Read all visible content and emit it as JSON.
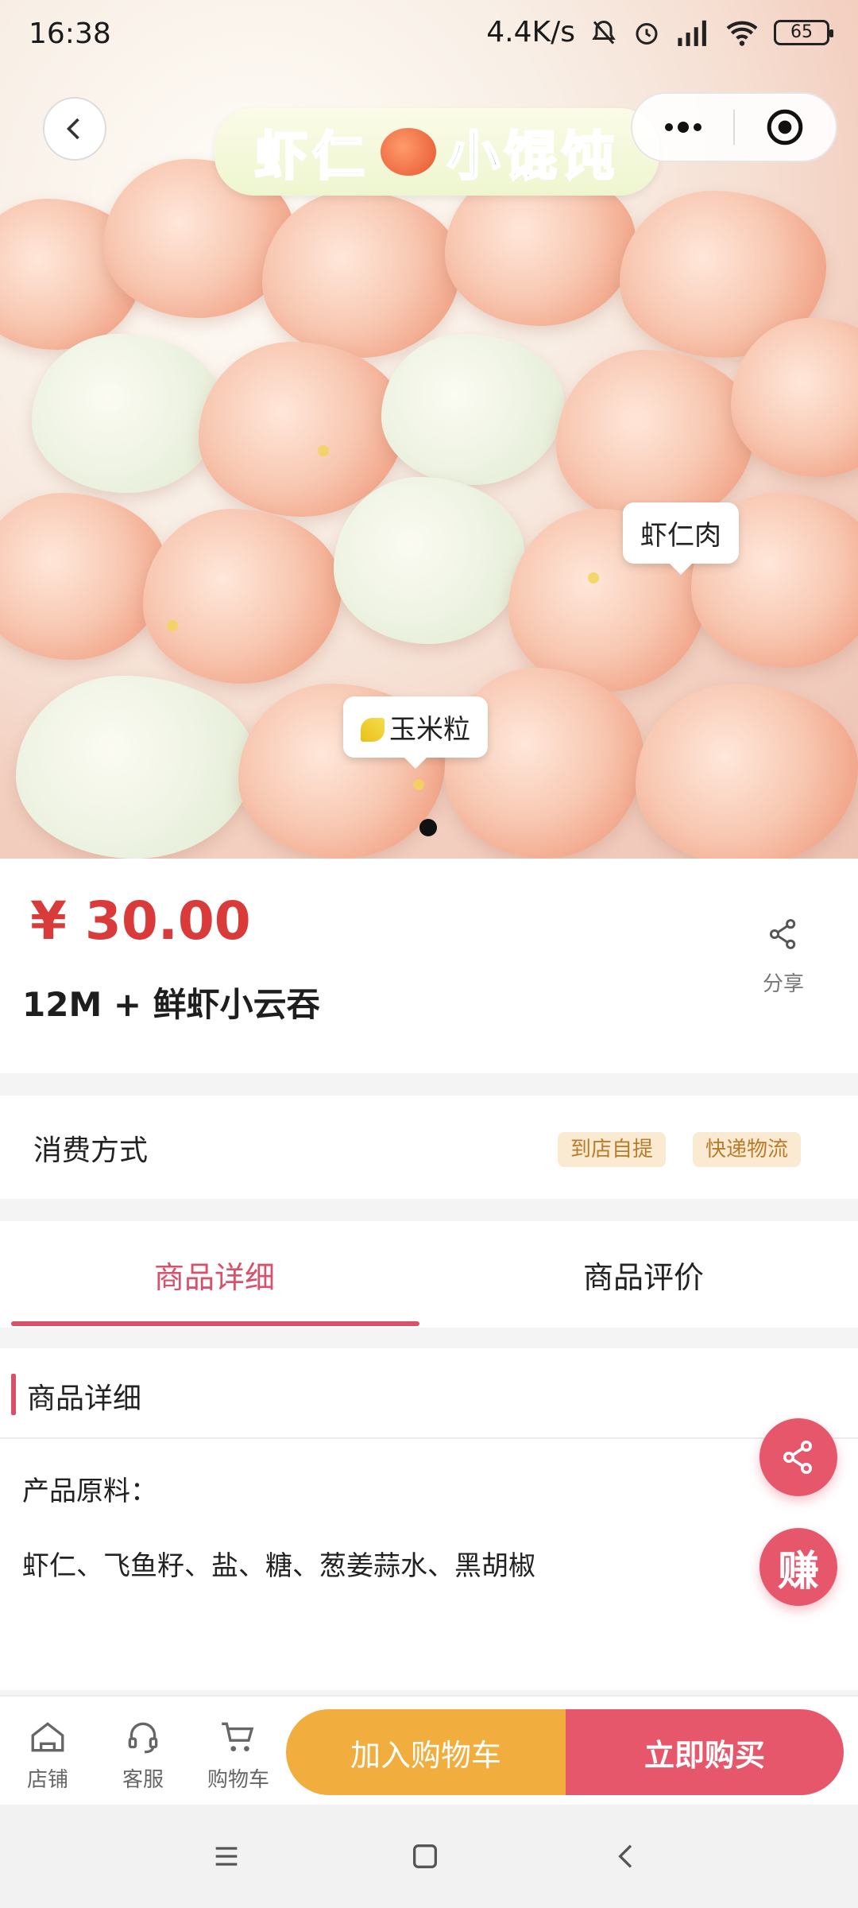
{
  "status_bar": {
    "time": "16:38",
    "network_speed": "4.4K/s",
    "battery": "65"
  },
  "hero": {
    "banner_text_left": "虾仁",
    "banner_text_right": "小馄饨",
    "tag_shrimp": "虾仁肉",
    "tag_corn": "玉米粒"
  },
  "product": {
    "price": "¥ 30.00",
    "title": "12M + 鲜虾小云吞",
    "share_label": "分享"
  },
  "consume": {
    "label": "消费方式",
    "options": [
      "到店自提",
      "快递物流"
    ]
  },
  "tabs": {
    "details": "商品详细",
    "reviews": "商品评价"
  },
  "detail": {
    "section_title": "商品详细",
    "materials_label": "产品原料：",
    "materials_value": "虾仁、飞鱼籽、盐、糖、葱姜蒜水、黑胡椒"
  },
  "floating": {
    "earn_label": "赚"
  },
  "bottom_bar": {
    "store": "店铺",
    "service": "客服",
    "cart": "购物车",
    "add_to_cart": "加入购物车",
    "buy_now": "立即购买"
  },
  "colors": {
    "accent": "#d8506a",
    "price": "#d93a3a",
    "cart_button": "#f1ad3d",
    "buy_button": "#e6576b"
  }
}
